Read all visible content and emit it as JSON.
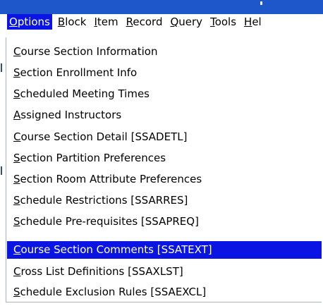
{
  "menubar": {
    "items": [
      {
        "mnemonic": "O",
        "rest": "ptions",
        "active": true
      },
      {
        "mnemonic": "B",
        "rest": "lock",
        "active": false
      },
      {
        "mnemonic": "I",
        "rest": "tem",
        "active": false
      },
      {
        "mnemonic": "R",
        "rest": "ecord",
        "active": false
      },
      {
        "mnemonic": "Q",
        "rest": "uery",
        "active": false
      },
      {
        "mnemonic": "T",
        "rest": "ools",
        "active": false
      },
      {
        "mnemonic": "H",
        "rest": "el",
        "active": false
      }
    ]
  },
  "options_menu": {
    "items": [
      {
        "mnemonic": "C",
        "rest": "ourse Section Information",
        "selected": false
      },
      {
        "mnemonic": "S",
        "rest": "ection Enrollment Info",
        "selected": false
      },
      {
        "mnemonic": "S",
        "rest": "cheduled Meeting Times",
        "selected": false
      },
      {
        "mnemonic": "A",
        "rest": "ssigned Instructors",
        "selected": false
      },
      {
        "mnemonic": "C",
        "rest": "ourse Section Detail [SSADETL]",
        "selected": false
      },
      {
        "mnemonic": "S",
        "rest": "ection Partition Preferences",
        "selected": false
      },
      {
        "mnemonic": "S",
        "rest": "ection Room Attribute Preferences",
        "selected": false
      },
      {
        "mnemonic": "S",
        "rest": "chedule Restrictions [SSARRES]",
        "selected": false
      },
      {
        "mnemonic": "S",
        "rest": "chedule Pre-requisites [SSAPREQ]",
        "selected": false
      },
      {
        "mnemonic": "C",
        "rest": "ourse Section Comments [SSATEXT]",
        "selected": true
      },
      {
        "mnemonic": "C",
        "rest": "ross List Definitions [SSAXLST]",
        "selected": false
      },
      {
        "mnemonic": "S",
        "rest": "chedule Exclusion Rules [SSAEXCL]",
        "selected": false
      }
    ]
  },
  "colors": {
    "titlebar": "#1e57c9",
    "highlight": "#0a15e3",
    "menu_border": "#a9b2bd"
  }
}
